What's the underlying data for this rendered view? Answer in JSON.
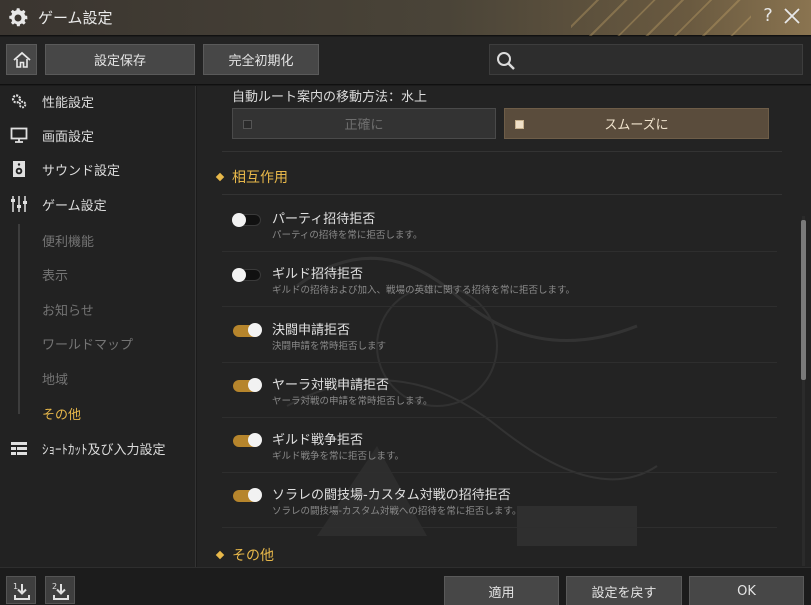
{
  "window": {
    "title": "ゲーム設定",
    "help_label": "?"
  },
  "toolbar": {
    "save_label": "設定保存",
    "reset_label": "完全初期化",
    "search_placeholder": "",
    "search_value": ""
  },
  "sidebar": {
    "items": [
      {
        "label": "性能設定",
        "icon": "gears-icon"
      },
      {
        "label": "画面設定",
        "icon": "monitor-icon"
      },
      {
        "label": "サウンド設定",
        "icon": "speaker-icon"
      },
      {
        "label": "ゲーム設定",
        "icon": "sliders-icon"
      }
    ],
    "subitems": [
      {
        "label": "便利機能"
      },
      {
        "label": "表示"
      },
      {
        "label": "お知らせ"
      },
      {
        "label": "ワールドマップ"
      },
      {
        "label": "地域"
      },
      {
        "label": "その他",
        "active": true
      }
    ],
    "shortcut": {
      "label": "ｼｮｰﾄｶｯﾄ及び入力設定",
      "icon": "keyboard-icon"
    }
  },
  "main": {
    "route_label": "自動ルート案内の移動方法：水上",
    "route_options": [
      {
        "label": "正確に",
        "selected": false
      },
      {
        "label": "スムーズに",
        "selected": true
      }
    ],
    "section_interaction": "相互作用",
    "section_other": "その他",
    "settings": [
      {
        "title": "パーティ招待拒否",
        "desc": "パーティの招待を常に拒否します。",
        "on": false
      },
      {
        "title": "ギルド招待拒否",
        "desc": "ギルドの招待および加入、戦場の英雄に関する招待を常に拒否します。",
        "on": false
      },
      {
        "title": "決闘申請拒否",
        "desc": "決闘申請を常時拒否します",
        "on": true
      },
      {
        "title": "ヤーラ対戦申請拒否",
        "desc": "ヤーラ対戦の申請を常時拒否します。",
        "on": true
      },
      {
        "title": "ギルド戦争拒否",
        "desc": "ギルド戦争を常に拒否します。",
        "on": true
      },
      {
        "title": "ソラレの闘技場-カスタム対戦の招待拒否",
        "desc": "ソラレの闘技場-カスタム対戦への招待を常に拒否します。",
        "on": true
      }
    ]
  },
  "footer": {
    "apply_label": "適用",
    "revert_label": "設定を戻す",
    "ok_label": "OK",
    "import1_label": "1",
    "import2_label": "2"
  },
  "colors": {
    "accent": "#e8b84a",
    "toggle_on": "#b6852c",
    "selected_option": "#5a4c3c"
  }
}
